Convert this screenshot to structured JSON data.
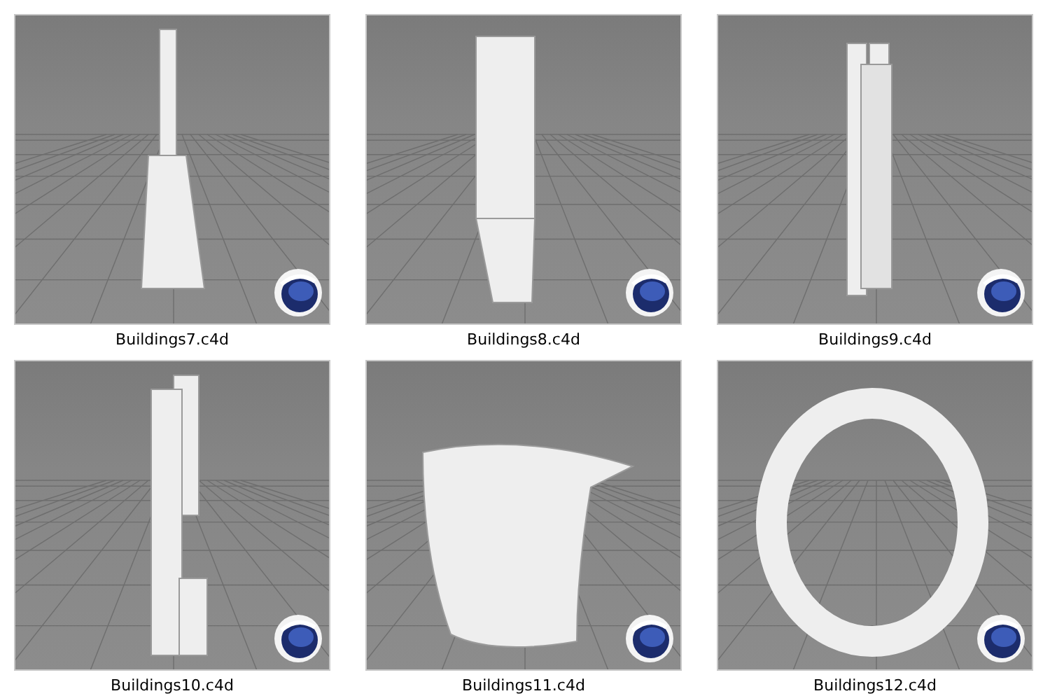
{
  "files": [
    {
      "name": "Buildings7.c4d",
      "kind": "spire"
    },
    {
      "name": "Buildings8.c4d",
      "kind": "tower"
    },
    {
      "name": "Buildings9.c4d",
      "kind": "twin"
    },
    {
      "name": "Buildings10.c4d",
      "kind": "stack"
    },
    {
      "name": "Buildings11.c4d",
      "kind": "wall"
    },
    {
      "name": "Buildings12.c4d",
      "kind": "ring"
    }
  ]
}
